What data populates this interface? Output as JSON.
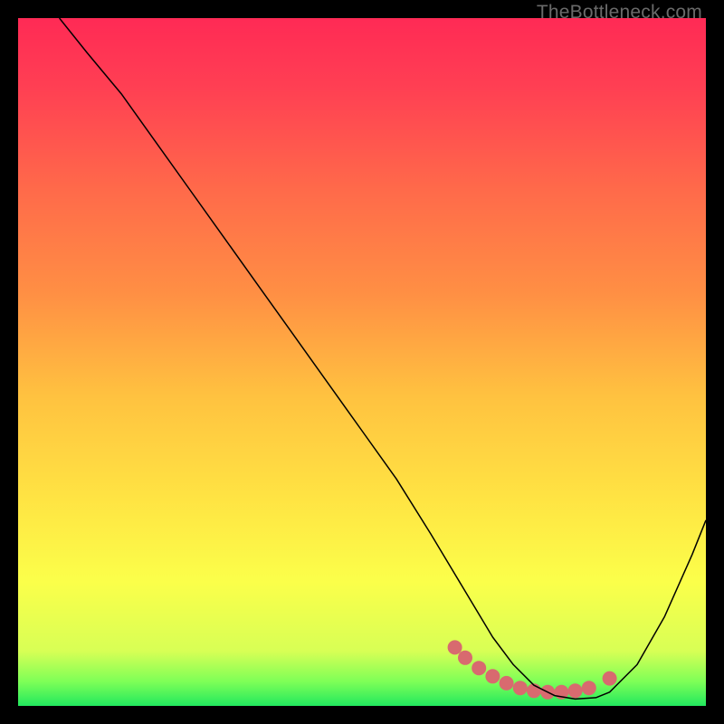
{
  "watermark": "TheBottleneck.com",
  "chart_data": {
    "type": "line",
    "title": "",
    "xlabel": "",
    "ylabel": "",
    "xlim": [
      0,
      100
    ],
    "ylim": [
      0,
      100
    ],
    "grid": false,
    "legend": false,
    "series": [
      {
        "name": "curve",
        "x": [
          6,
          10,
          15,
          20,
          25,
          30,
          35,
          40,
          45,
          50,
          55,
          60,
          63,
          66,
          69,
          72,
          75,
          78,
          81,
          84,
          86,
          90,
          94,
          98,
          100
        ],
        "y": [
          100,
          95,
          89,
          82,
          75,
          68,
          61,
          54,
          47,
          40,
          33,
          25,
          20,
          15,
          10,
          6,
          3,
          1.5,
          1,
          1.2,
          2,
          6,
          13,
          22,
          27
        ],
        "stroke": "#000000",
        "stroke_width": 1.5
      },
      {
        "name": "highlight-dots",
        "type": "scatter",
        "x": [
          63.5,
          65,
          67,
          69,
          71,
          73,
          75,
          77,
          79,
          81,
          83,
          86
        ],
        "y": [
          8.5,
          7,
          5.5,
          4.3,
          3.3,
          2.6,
          2.2,
          2,
          2,
          2.2,
          2.6,
          4.0
        ],
        "color": "#d86a6f",
        "radius": 8
      }
    ],
    "background_gradient": {
      "stops": [
        {
          "offset": 0.0,
          "color": "#ff2a55"
        },
        {
          "offset": 0.1,
          "color": "#ff3f53"
        },
        {
          "offset": 0.25,
          "color": "#ff6a4a"
        },
        {
          "offset": 0.4,
          "color": "#ff8f44"
        },
        {
          "offset": 0.55,
          "color": "#ffc240"
        },
        {
          "offset": 0.7,
          "color": "#ffe443"
        },
        {
          "offset": 0.82,
          "color": "#fbff4a"
        },
        {
          "offset": 0.92,
          "color": "#d8ff55"
        },
        {
          "offset": 0.965,
          "color": "#7dff57"
        },
        {
          "offset": 1.0,
          "color": "#22e85e"
        }
      ]
    }
  }
}
